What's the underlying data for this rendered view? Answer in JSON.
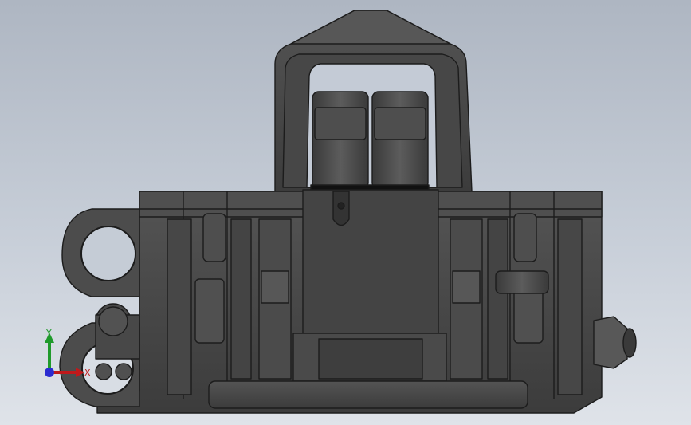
{
  "viewport": {
    "background_top": "#aeb6c2",
    "background_bottom": "#dfe3e9",
    "model_color": "#4a4a4a",
    "edge_color": "#1c1c1c"
  },
  "triad": {
    "x_label": "X",
    "y_label": "Y",
    "x_color": "#c0191b",
    "y_color": "#1f9a2b",
    "z_color": "#2b2bd0"
  }
}
